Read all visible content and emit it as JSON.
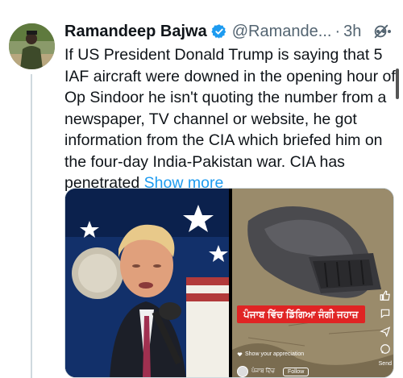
{
  "tweet": {
    "author_name": "Ramandeep Bajwa",
    "handle": "@Ramande...",
    "separator": "·",
    "time": "3h",
    "body": "If US President Donald Trump is saying that 5\nIAF aircraft were downed in the opening hour of\nOp Sindoor  he isn't quoting the number from a\nnewspaper, TV channel or website, he got\ninformation from the CIA which briefed him on\nthe four-day India-Pakistan war. CIA has\npenetrated ",
    "show_more": "Show more"
  },
  "media": {
    "left_image": "trump-speaking-photo",
    "right_image": "aircraft-wreckage-photo",
    "caption_badge": "ਪੰਜਾਬ ਵਿੱਚ ਡਿੱਗਿਆ ਜੰਗੀ ਜਹਾਜ਼",
    "appreciation": "Show your appreciation",
    "reel_user": "ਪੰਜਾਬ ਦਿੱਚ",
    "follow": "Follow",
    "share_label": "Send"
  },
  "colors": {
    "accent": "#1d9bf0",
    "text": "#0f1419",
    "muted": "#536471",
    "badge": "#e02424"
  },
  "icons": [
    "verified-badge-icon",
    "grok-icon",
    "more-icon",
    "like-icon",
    "comment-icon",
    "share-icon",
    "heart-icon"
  ]
}
